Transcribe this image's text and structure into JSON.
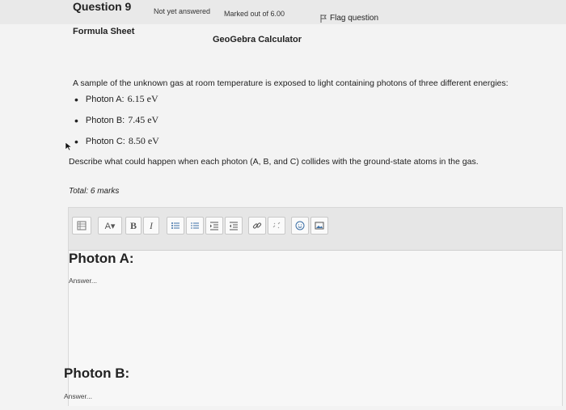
{
  "header": {
    "question_number": "Question 9",
    "status": "Not yet answered",
    "marks": "Marked out of 6.00",
    "flag_label": "Flag question"
  },
  "tools": {
    "formula_sheet": "Formula Sheet",
    "geogebra": "GeoGebra Calculator"
  },
  "question": {
    "intro": "A sample of the unknown gas at room temperature is exposed to light containing photons of three different energies:",
    "photons": [
      {
        "label": "Photon A:",
        "value": "6.15 eV"
      },
      {
        "label": "Photon B:",
        "value": "7.45 eV"
      },
      {
        "label": "Photon C:",
        "value": "8.50 eV"
      }
    ],
    "prompt": "Describe what could happen when each photon (A, B, and C) collides with the ground-state atoms in the gas.",
    "total": "Total: 6 marks"
  },
  "editor": {
    "toolbar": {
      "font_label": "A▾",
      "bold_label": "B",
      "italic_label": "I"
    },
    "content": {
      "heading_a": "Photon A:",
      "answer_a": "Answer...",
      "heading_b": "Photon B:",
      "answer_b": "Answer..."
    }
  },
  "icons": [
    "flag-icon",
    "cursor-icon",
    "expand-icon",
    "bullet-list-icon",
    "numbered-list-icon",
    "indent-icon",
    "outdent-icon",
    "link-icon",
    "unlink-icon",
    "emoji-icon",
    "image-icon"
  ]
}
